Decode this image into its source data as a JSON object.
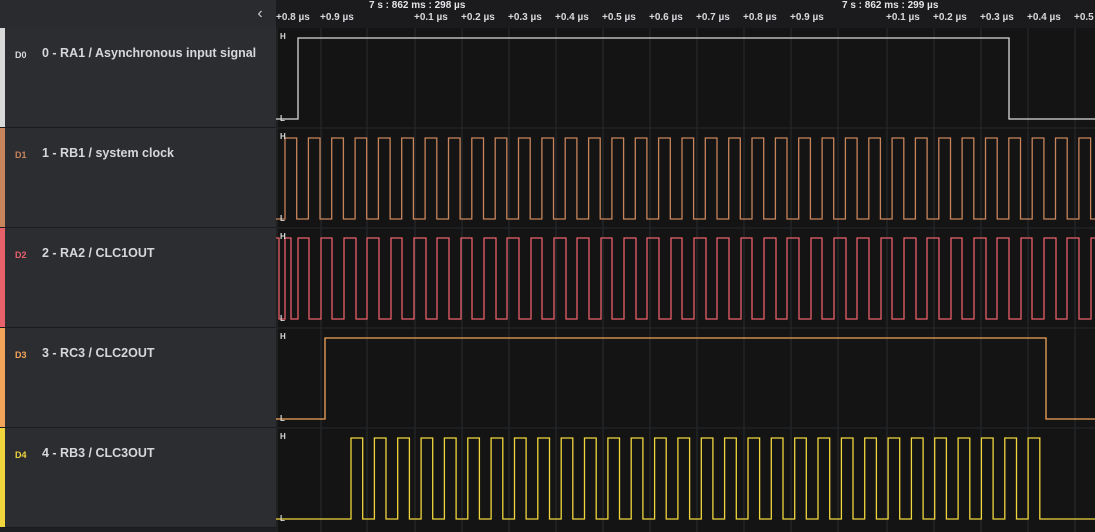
{
  "ruler": {
    "ticks": [
      "+0.8 µs",
      "+0.9 µs",
      "+0.1 µs",
      "+0.2 µs",
      "+0.3 µs",
      "+0.4 µs",
      "+0.5 µs",
      "+0.6 µs",
      "+0.7 µs",
      "+0.8 µs",
      "+0.9 µs",
      "+0.1 µs",
      "+0.2 µs",
      "+0.3 µs",
      "+0.4 µs",
      "+0.5"
    ],
    "markers": [
      "7 s : 862 ms : 298 µs",
      "7 s : 862 ms : 299 µs"
    ]
  },
  "channels": [
    {
      "id": "D0",
      "name": "0 - RA1 / Asynchronous input signal",
      "color": "#d9d9d9"
    },
    {
      "id": "D1",
      "name": "1 - RB1 / system clock",
      "color": "#c8845a"
    },
    {
      "id": "D2",
      "name": "2 - RA2 / CLC1OUT",
      "color": "#e8606a"
    },
    {
      "id": "D3",
      "name": "3 - RC3 / CLC2OUT",
      "color": "#f2a55a"
    },
    {
      "id": "D4",
      "name": "4 - RB3 / CLC3OUT",
      "color": "#f0d53c"
    }
  ],
  "levels": {
    "high": "H",
    "low": "L"
  }
}
